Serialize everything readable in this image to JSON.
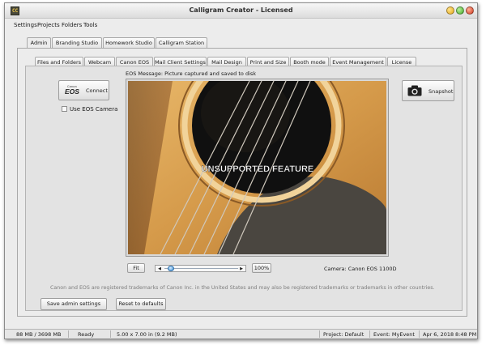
{
  "window": {
    "title": "Calligram Creator - Licensed",
    "app_icon_text": "CC"
  },
  "menu": [
    "Settings",
    "Projects",
    "Folders",
    "Tools"
  ],
  "top_tabs": [
    {
      "label": "Admin",
      "active": true
    },
    {
      "label": "Branding Studio",
      "active": false
    },
    {
      "label": "Homework Studio",
      "active": false
    },
    {
      "label": "Calligram Station",
      "active": false
    }
  ],
  "inner_tabs": [
    {
      "label": "Files and Folders",
      "active": false
    },
    {
      "label": "Webcam",
      "active": false
    },
    {
      "label": "Canon EOS",
      "active": true
    },
    {
      "label": "Mail Client Settings",
      "active": false
    },
    {
      "label": "Mail Design",
      "active": false
    },
    {
      "label": "Print and Size",
      "active": false
    },
    {
      "label": "Booth mode",
      "active": false
    },
    {
      "label": "Event Management",
      "active": false
    },
    {
      "label": "License",
      "active": false
    }
  ],
  "eos": {
    "connect_label": "Connect",
    "logo_small": "Canon",
    "logo_big": "EOS",
    "use_camera_label": "Use EOS Camera",
    "use_camera_checked": false,
    "message": "EOS Message: Picture captured and saved to disk",
    "overlay_text": "UNSUPPORTED FEATURE",
    "snapshot_label": "Snapshot",
    "fit_label": "Fit",
    "zoom_level": "100%",
    "zoom_slider_fraction": 0.05,
    "camera_info": "Camera: Canon EOS 1100D",
    "trademark": "Canon and EOS are registered trademarks of Canon Inc. in the United States and may also be registered trademarks or trademarks in other countries."
  },
  "buttons": {
    "save": "Save admin settings",
    "reset": "Reset to defaults"
  },
  "status": {
    "memory": "88 MB / 3698 MB",
    "state": "Ready",
    "size": "5.00 x 7.00 in  (9.2 MB)",
    "project": "Project: Default",
    "event": "Event: MyEvent",
    "date": "Apr 6, 2018",
    "time": "8:48 PM"
  },
  "colors": {
    "guitar_wood": "#d59a4a",
    "soundhole": "#101010",
    "pickguard": "#4a4640"
  }
}
